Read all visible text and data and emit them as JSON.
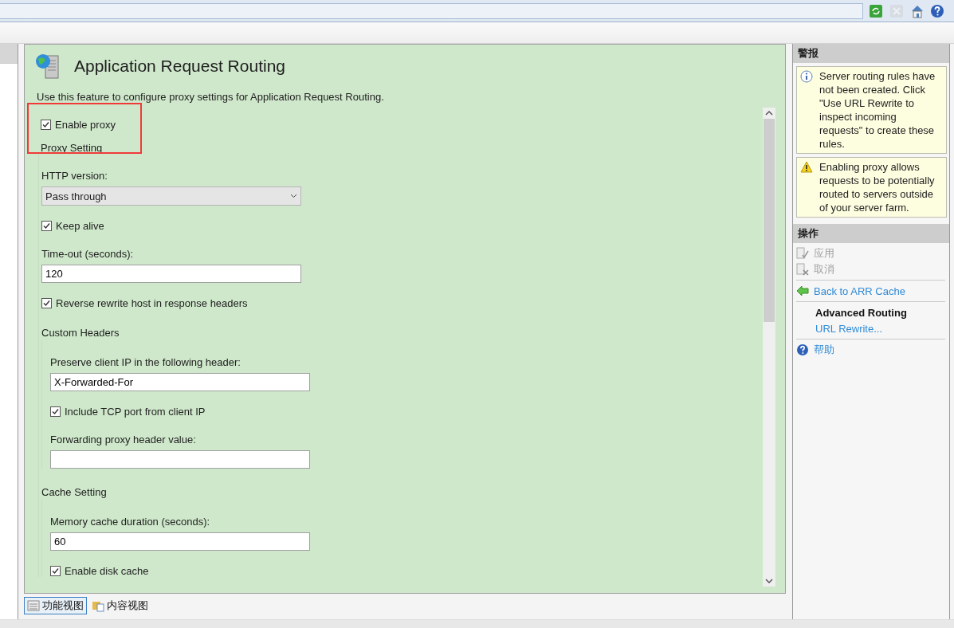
{
  "toolbar": {
    "buttons": [
      {
        "kind": "refresh",
        "disabled": false
      },
      {
        "kind": "stop",
        "disabled": true
      },
      {
        "kind": "home",
        "disabled": false
      },
      {
        "kind": "help",
        "disabled": false
      }
    ]
  },
  "feature": {
    "title": "Application Request Routing",
    "description": "Use this feature to configure proxy settings for Application Request Routing.",
    "enable_proxy": {
      "label": "Enable proxy",
      "checked": true
    },
    "group": {
      "title": "Proxy Setting",
      "items": [
        {
          "kind": "select",
          "label": "HTTP version:",
          "value": "Pass through"
        },
        {
          "kind": "checkbox",
          "label": "Keep alive",
          "checked": true
        },
        {
          "kind": "field",
          "label": "Time-out (seconds):",
          "value": "120"
        },
        {
          "kind": "checkbox",
          "label": "Reverse rewrite host in response headers",
          "checked": true
        },
        {
          "kind": "group",
          "title": "Custom Headers",
          "items": [
            {
              "kind": "field",
              "label": "Preserve client IP in the following header:",
              "value": "X-Forwarded-For"
            },
            {
              "kind": "checkbox",
              "label": "Include TCP port from client IP",
              "checked": true
            },
            {
              "kind": "field",
              "label": "Forwarding proxy header value:"
            }
          ]
        },
        {
          "kind": "group",
          "title": "Cache Setting",
          "items": [
            {
              "kind": "field",
              "label": "Memory cache duration (seconds):",
              "value": "60"
            },
            {
              "kind": "checkbox",
              "label": "Enable disk cache",
              "checked": true
            }
          ]
        }
      ]
    }
  },
  "view_tabs": [
    {
      "label": "功能视图",
      "selected": true
    },
    {
      "label": "内容视图",
      "selected": false
    }
  ],
  "alerts": {
    "title": "警报",
    "items": [
      {
        "kind": "info",
        "text": "Server routing rules have not been created. Click \"Use URL Rewrite to inspect incoming requests\" to create these rules."
      },
      {
        "kind": "warning",
        "text": "Enabling proxy allows requests to be potentially routed to servers outside of your server farm."
      }
    ]
  },
  "actions": {
    "title": "操作",
    "groups": [
      [
        {
          "kind": "apply",
          "label": "应用",
          "disabled": true
        },
        {
          "kind": "cancel",
          "label": "取消",
          "disabled": true
        }
      ],
      [
        {
          "kind": "back",
          "label": "Back to ARR Cache",
          "disabled": false
        }
      ],
      [
        {
          "kind": "heading",
          "label": "Advanced Routing"
        },
        {
          "kind": "link",
          "label": "URL Rewrite...",
          "disabled": false
        }
      ],
      [
        {
          "kind": "help",
          "label": "帮助",
          "disabled": false
        }
      ]
    ]
  }
}
